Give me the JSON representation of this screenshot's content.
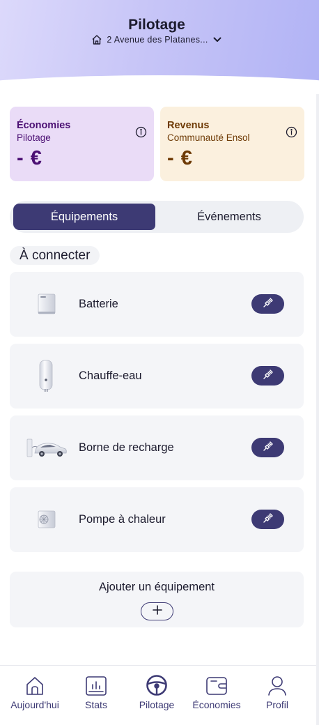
{
  "header": {
    "title": "Pilotage",
    "address": "2 Avenue des Platanes..."
  },
  "cards": {
    "economies": {
      "title": "Économies",
      "subtitle": "Pilotage",
      "value": "- €"
    },
    "revenus": {
      "title": "Revenus",
      "subtitle": "Communauté Ensol",
      "value": "- €"
    }
  },
  "tabs": {
    "active": "Équipements",
    "inactive": "Événements"
  },
  "section_label": "À connecter",
  "equipments": [
    {
      "label": "Batterie",
      "icon": "battery-icon"
    },
    {
      "label": "Chauffe-eau",
      "icon": "water-heater-icon"
    },
    {
      "label": "Borne de recharge",
      "icon": "ev-charger-icon"
    },
    {
      "label": "Pompe à chaleur",
      "icon": "heat-pump-icon"
    }
  ],
  "add_equipment": {
    "label": "Ajouter un équipement"
  },
  "nav": [
    {
      "label": "Aujourd'hui",
      "icon": "home-icon"
    },
    {
      "label": "Stats",
      "icon": "chart-icon"
    },
    {
      "label": "Pilotage",
      "icon": "steering-wheel-icon"
    },
    {
      "label": "Économies",
      "icon": "wallet-icon"
    },
    {
      "label": "Profil",
      "icon": "user-icon"
    }
  ],
  "colors": {
    "primary": "#3d3a74",
    "economies_bg": "#eadcf7",
    "economies_text": "#4b0f73",
    "revenus_bg": "#fbf0de",
    "revenus_text": "#6e3a05"
  }
}
